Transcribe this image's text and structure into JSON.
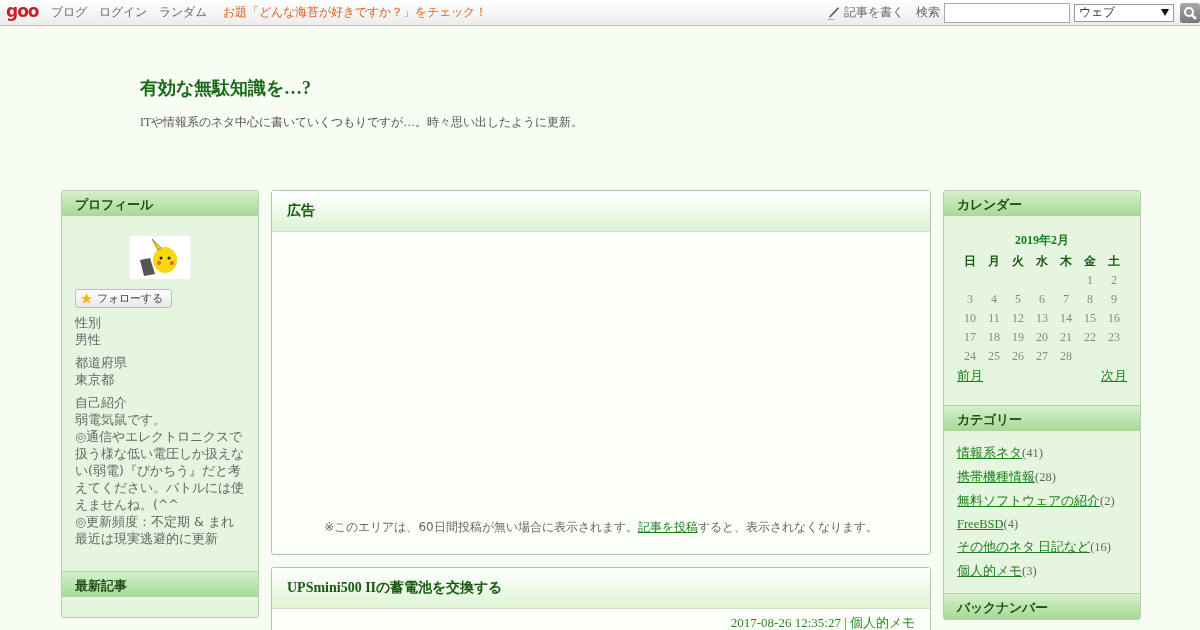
{
  "topbar": {
    "logo": "goo",
    "links": [
      "ブログ",
      "ログイン",
      "ランダム"
    ],
    "topic": "お題「どんな海苔が好きですか？」をチェック！",
    "write": "記事を書く",
    "search_label": "検索",
    "search_scope": "ウェブ"
  },
  "blog": {
    "title": "有効な無駄知識を…?",
    "description": "ITや情報系のネタ中心に書いていくつもりですが…。時々思い出したように更新。"
  },
  "profile": {
    "title": "プロフィール",
    "follow": "フォローする",
    "fields": [
      {
        "label": "性別",
        "lines": [
          "男性"
        ]
      },
      {
        "label": "都道府県",
        "lines": [
          "東京都"
        ]
      },
      {
        "label": "自己紹介",
        "lines": [
          "弱電気鼠です。",
          "◎通信やエレクトロニクスで扱う様な低い電圧しか扱えない(弱電)『ぴかちう』だと考えてください。バトルには使えませんね。(^^",
          "◎更新頻度：不定期 & まれ",
          "最近は現実逃避的に更新"
        ]
      }
    ]
  },
  "recent": {
    "title": "最新記事"
  },
  "ad": {
    "title": "広告",
    "notice": {
      "before": "※このエリアは、60日間投稿が無い場合に表示されます。",
      "link": "記事を投稿",
      "after": "すると、表示されなくなります。"
    }
  },
  "post": {
    "title": "UPSmini500 IIの蓄電池を交換する",
    "date": "2017-08-26 12:35:27",
    "separator": "|",
    "category": "個人的メモ"
  },
  "calendar": {
    "title": "カレンダー",
    "month": "2019年2月",
    "weekdays": [
      "日",
      "月",
      "火",
      "水",
      "木",
      "金",
      "土"
    ],
    "weeks": [
      [
        "1",
        "2"
      ],
      [
        "3",
        "4",
        "5",
        "6",
        "7",
        "8",
        "9"
      ],
      [
        "10",
        "11",
        "12",
        "13",
        "14",
        "15",
        "16"
      ],
      [
        "17",
        "18",
        "19",
        "20",
        "21",
        "22",
        "23"
      ],
      [
        "24",
        "25",
        "26",
        "27",
        "28"
      ]
    ],
    "prev": "前月",
    "next": "次月"
  },
  "categories": {
    "title": "カテゴリー",
    "items": [
      {
        "name": "情報系ネタ",
        "count": "(41)"
      },
      {
        "name": "携帯機種情報",
        "count": "(28)"
      },
      {
        "name": "無料ソフトウェアの紹介",
        "count": "(2)"
      },
      {
        "name": "FreeBSD",
        "count": "(4)"
      },
      {
        "name": "その他のネタ 日記など",
        "count": "(16)"
      },
      {
        "name": "個人的メモ",
        "count": "(3)"
      }
    ]
  },
  "backnumber": {
    "title": "バックナンバー"
  }
}
